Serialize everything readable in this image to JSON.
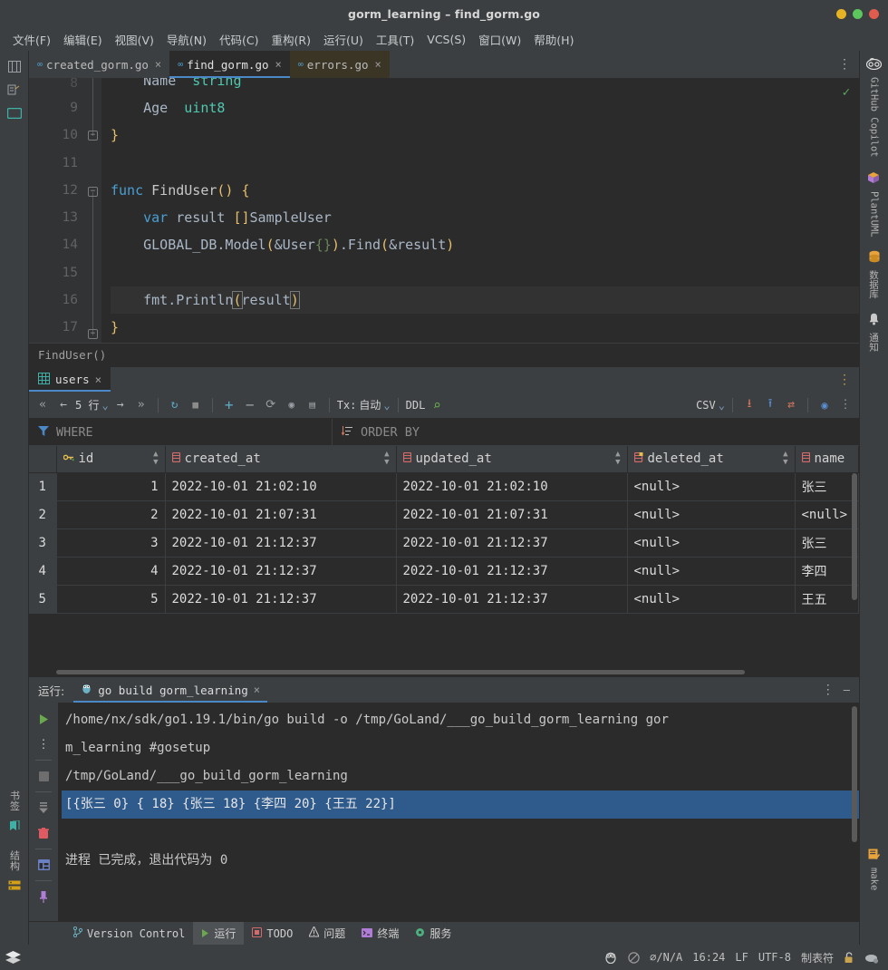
{
  "window": {
    "title": "gorm_learning – find_gorm.go",
    "buttons": [
      {
        "name": "minimize",
        "color": "#e6b325"
      },
      {
        "name": "maximize",
        "color": "#5cc75c"
      },
      {
        "name": "close",
        "color": "#e05c4e"
      }
    ]
  },
  "menubar": {
    "items": [
      "文件(F)",
      "编辑(E)",
      "视图(V)",
      "导航(N)",
      "代码(C)",
      "重构(R)",
      "运行(U)",
      "工具(T)",
      "VCS(S)",
      "窗口(W)",
      "帮助(H)"
    ]
  },
  "left_strip": {
    "top_icons": [
      "project-icon",
      "commit-icon",
      "terminal-icon"
    ],
    "bottom_labels": [
      "书签",
      "结构"
    ],
    "bottom_icons": [
      "bookmark-icon",
      "structure-icon"
    ]
  },
  "right_strip": {
    "items": [
      {
        "label": "GitHub Copilot",
        "icon": "copilot-icon"
      },
      {
        "label": "PlantUML",
        "icon": "plantuml-icon"
      },
      {
        "label": "数据库",
        "icon": "database-icon"
      },
      {
        "label": "通知",
        "icon": "bell-icon"
      }
    ],
    "bottom": {
      "label": "make",
      "icon": "make-icon"
    }
  },
  "editor_tabs": {
    "tabs": [
      {
        "label": "created_gorm.go",
        "state": "inactive"
      },
      {
        "label": "find_gorm.go",
        "state": "active"
      },
      {
        "label": "errors.go",
        "state": "modified"
      }
    ],
    "close_glyph": "×",
    "more_glyph": "⋮"
  },
  "editor": {
    "lines": [
      {
        "num": "",
        "partial": true
      },
      {
        "num": "9",
        "text": "        Age  uint8"
      },
      {
        "num": "10",
        "text": "    }"
      },
      {
        "num": "11",
        "text": ""
      },
      {
        "num": "12",
        "text": "    func FindUser() {"
      },
      {
        "num": "13",
        "text": "        var result []SampleUser"
      },
      {
        "num": "14",
        "text": "        GLOBAL_DB.Model(&User{}).Find(&result)"
      },
      {
        "num": "15",
        "text": ""
      },
      {
        "num": "16",
        "text": "        fmt.Println(result)"
      },
      {
        "num": "17",
        "text": "    }"
      }
    ],
    "partial_line_text": "Name  string",
    "partial_line_num": "8",
    "inspection_mark": "✓"
  },
  "breadcrumb": {
    "text": "FindUser()"
  },
  "db_panel": {
    "tab": {
      "label": "users",
      "icon": "table-icon",
      "close": "×"
    },
    "more_glyph": "⋮",
    "toolbar": {
      "first_page": "«",
      "prev_page": "←",
      "rows_label": "5 行",
      "rows_caret": "⌄",
      "next_page": "→",
      "last_page": "»",
      "refresh": "↻",
      "stop": "■",
      "add_row": "+",
      "remove_row": "−",
      "revert": "⟳",
      "preview": "◉",
      "commit": "▤",
      "tx_label": "Tx:",
      "tx_value": "自动",
      "tx_caret": "⌄",
      "ddl_label": "DDL",
      "search": "⌕",
      "export_format": "CSV",
      "export_caret": "⌄",
      "download": "⭳",
      "upload": "⭱",
      "compare": "⇄",
      "view": "◉",
      "options": "⋮"
    },
    "filters": {
      "where_label": "WHERE",
      "where_icon": "filter-icon",
      "order_label": "ORDER BY",
      "order_icon": "sort-icon"
    },
    "grid": {
      "columns": [
        {
          "name": "id",
          "icon": "primary-key-icon",
          "sortable": true
        },
        {
          "name": "created_at",
          "icon": "column-icon",
          "sortable": true
        },
        {
          "name": "updated_at",
          "icon": "column-icon",
          "sortable": true
        },
        {
          "name": "deleted_at",
          "icon": "indexed-column-icon",
          "sortable": true
        },
        {
          "name": "name",
          "icon": "column-icon",
          "sortable": false
        }
      ],
      "rows": [
        {
          "n": "1",
          "id": "1",
          "created_at": "2022-10-01 21:02:10",
          "updated_at": "2022-10-01 21:02:10",
          "deleted_at": "<null>",
          "name": "张三"
        },
        {
          "n": "2",
          "id": "2",
          "created_at": "2022-10-01 21:07:31",
          "updated_at": "2022-10-01 21:07:31",
          "deleted_at": "<null>",
          "name": "<null>"
        },
        {
          "n": "3",
          "id": "3",
          "created_at": "2022-10-01 21:12:37",
          "updated_at": "2022-10-01 21:12:37",
          "deleted_at": "<null>",
          "name": "张三"
        },
        {
          "n": "4",
          "id": "4",
          "created_at": "2022-10-01 21:12:37",
          "updated_at": "2022-10-01 21:12:37",
          "deleted_at": "<null>",
          "name": "李四"
        },
        {
          "n": "5",
          "id": "5",
          "created_at": "2022-10-01 21:12:37",
          "updated_at": "2022-10-01 21:12:37",
          "deleted_at": "<null>",
          "name": "王五"
        }
      ]
    }
  },
  "run_panel": {
    "label": "运行:",
    "config_name": "go build gorm_learning",
    "config_icon": "go-gopher-icon",
    "close": "×",
    "more": "⋮",
    "minimize": "—",
    "gutter_icons": [
      "rerun-icon",
      "more-icon",
      "stop-icon",
      "scroll-to-end-icon",
      "trash-icon",
      "layout-icon",
      "pin-icon"
    ],
    "console_lines": [
      {
        "text": "/home/nx/sdk/go1.19.1/bin/go build -o /tmp/GoLand/___go_build_gorm_learning gor",
        "selected": false
      },
      {
        "text": "m_learning #gosetup",
        "selected": false
      },
      {
        "text": "/tmp/GoLand/___go_build_gorm_learning",
        "selected": false
      },
      {
        "text": "[{张三 0} { 18} {张三 18} {李四 20} {王五 22}]",
        "selected": true
      },
      {
        "text": "",
        "selected": false
      },
      {
        "text": "进程 已完成，退出代码为 0",
        "selected": false
      }
    ]
  },
  "bottom_bar": {
    "items": [
      {
        "label": "Version Control",
        "icon": "branch-icon",
        "active": false
      },
      {
        "label": "运行",
        "icon": "run-icon",
        "active": true
      },
      {
        "label": "TODO",
        "icon": "todo-icon",
        "active": false
      },
      {
        "label": "问题",
        "icon": "problems-icon",
        "active": false
      },
      {
        "label": "终端",
        "icon": "terminal-icon",
        "active": false
      },
      {
        "label": "服务",
        "icon": "services-icon",
        "active": false
      }
    ]
  },
  "status_bar": {
    "left_icon": "stack-icon",
    "right_items": [
      {
        "type": "icon",
        "name": "gopher-icon"
      },
      {
        "type": "icon",
        "name": "no-access-icon"
      },
      {
        "type": "text",
        "value": "∅/N/A"
      },
      {
        "type": "text",
        "value": "16:24"
      },
      {
        "type": "text",
        "value": "LF"
      },
      {
        "type": "text",
        "value": "UTF-8"
      },
      {
        "type": "text",
        "value": "制表符"
      },
      {
        "type": "icon",
        "name": "lock-icon"
      },
      {
        "type": "icon",
        "name": "cloud-icon"
      }
    ]
  },
  "colors": {
    "accent": "#4a88c7",
    "panel": "#3c3f41",
    "editor_bg": "#2b2b2b",
    "selection": "#2f5a8c",
    "null_green": "#6a8759",
    "keyword_orange": "#cc7832"
  }
}
